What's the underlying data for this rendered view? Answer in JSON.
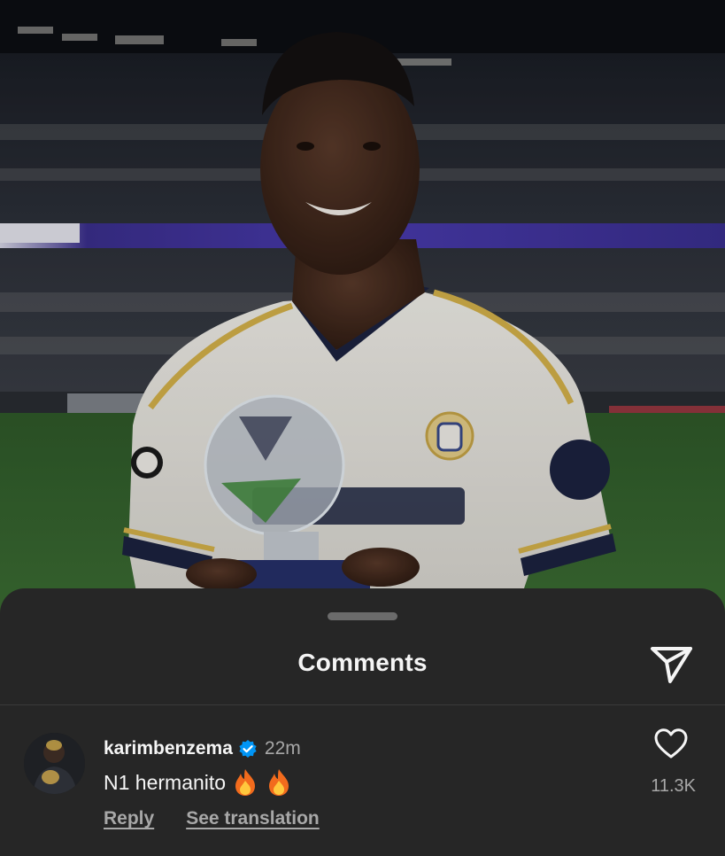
{
  "post": {
    "image": {
      "subject": "player holding trophy",
      "icon": "photo"
    }
  },
  "comments_sheet": {
    "title": "Comments",
    "share_icon": "paper-plane-icon",
    "comments": [
      {
        "username": "karimbenzema",
        "verified": true,
        "time": "22m",
        "text": "N1 hermanito",
        "emoji": [
          "🔥",
          "🔥"
        ],
        "reply_label": "Reply",
        "translate_label": "See translation",
        "like_icon": "heart-outline-icon",
        "like_count": "11.3K"
      }
    ]
  },
  "colors": {
    "sheet_background": "#262626",
    "primary_text": "#f5f5f5",
    "secondary_text": "#a8a8a8",
    "verified_blue": "#0095f6"
  }
}
